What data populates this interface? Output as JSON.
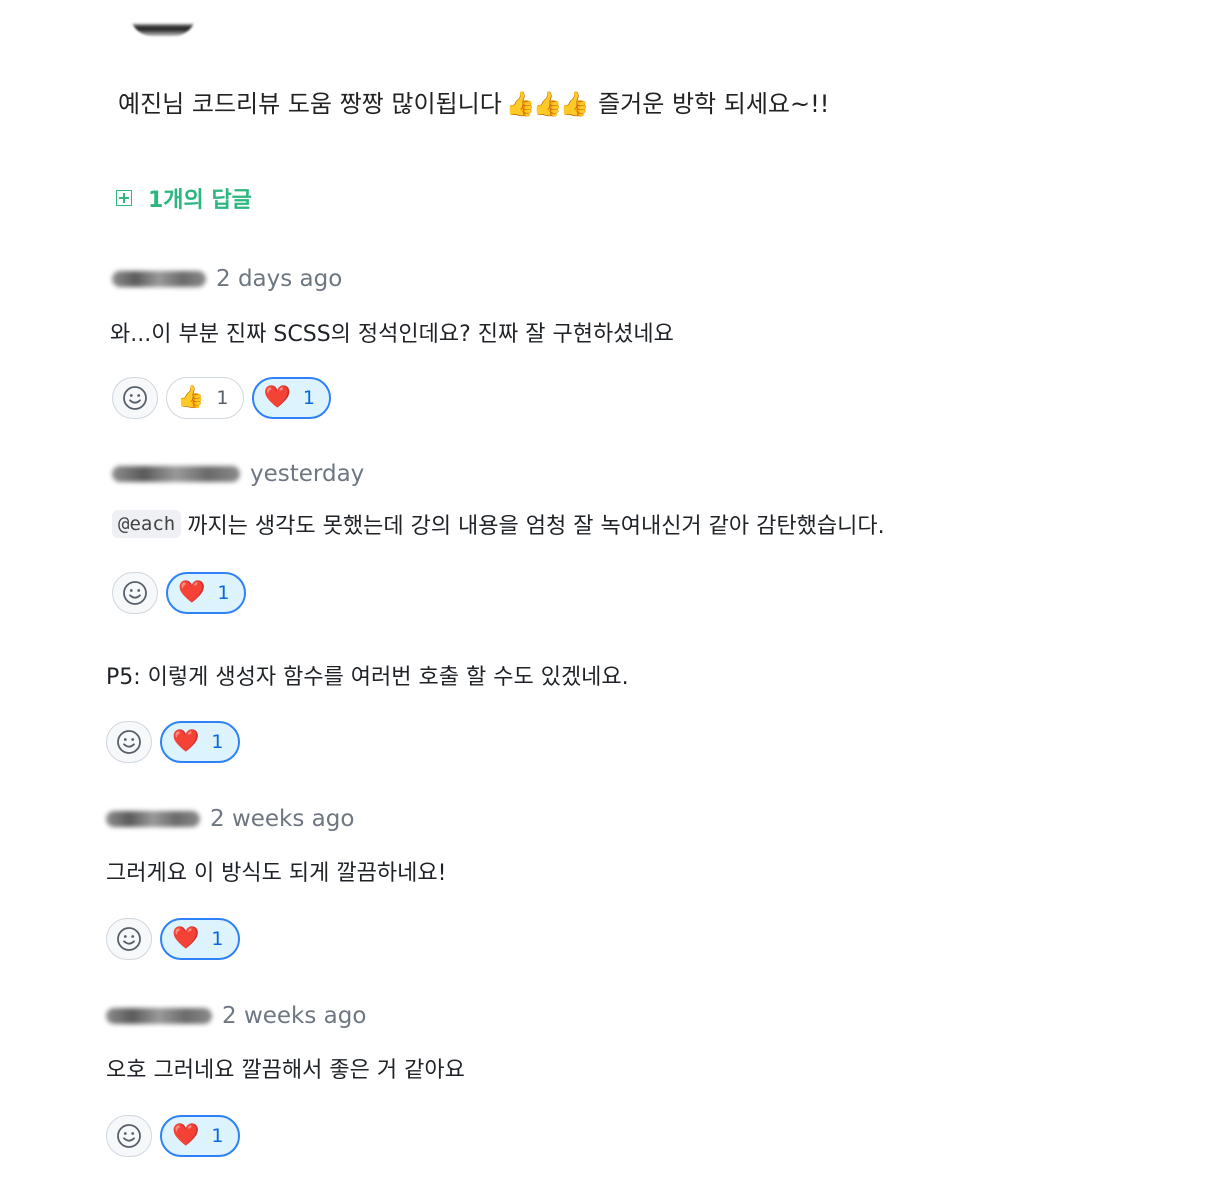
{
  "post": {
    "comment_text": "예진님 코드리뷰 도움 짱짱 많이됩니다",
    "comment_emoji": "👍👍👍",
    "comment_tail": " 즐거운 방학 되세요~!!",
    "replies_toggle_label": "1개의 답글"
  },
  "replies": [
    {
      "time": "2 days ago",
      "mention": "",
      "text": "와...이 부분 진짜 SCSS의 정석인데요? 진짜 잘 구현하셨네요",
      "reactions": [
        {
          "emoji": "👍",
          "count": "1"
        },
        {
          "emoji": "❤️",
          "count": "1"
        }
      ]
    },
    {
      "time": "yesterday",
      "mention": "@each",
      "text": "까지는 생각도 못했는데 강의 내용을 엄청 잘 녹여내신거 같아 감탄했습니다.",
      "reactions": [
        {
          "emoji": "❤️",
          "count": "1"
        }
      ]
    },
    {
      "time": "",
      "mention": "",
      "text": "P5: 이렇게 생성자 함수를 여러번 호출 할 수도 있겠네요.",
      "reactions": [
        {
          "emoji": "❤️",
          "count": "1"
        }
      ]
    },
    {
      "time": "2 weeks ago",
      "mention": "",
      "text": "그러게요 이 방식도 되게 깔끔하네요!",
      "reactions": [
        {
          "emoji": "❤️",
          "count": "1"
        }
      ]
    },
    {
      "time": "2 weeks ago",
      "mention": "",
      "text": "오호 그러네요 깔끔해서 좋은 거 같아요",
      "reactions": [
        {
          "emoji": "❤️",
          "count": "1"
        }
      ]
    }
  ],
  "icons": {
    "add_reaction": "smiley-face-icon",
    "replies_toggle": "plus-square-icon"
  },
  "colors": {
    "accent_green": "#2db77f",
    "reaction_active_border": "#2f81f7",
    "reaction_active_bg": "#ddf4ff"
  }
}
